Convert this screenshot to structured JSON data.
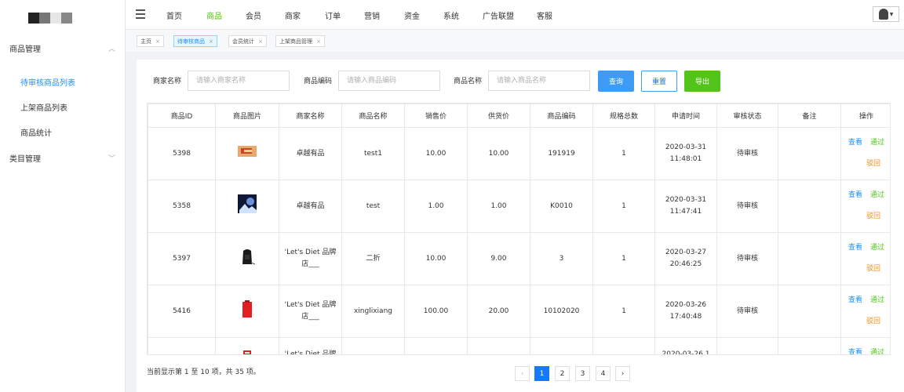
{
  "nav": {
    "items": [
      "首页",
      "商品",
      "会员",
      "商家",
      "订单",
      "营销",
      "资金",
      "系统",
      "广告联盟",
      "客服"
    ],
    "active": "商品"
  },
  "sidebar": {
    "groups": [
      {
        "label": "商品管理",
        "items": [
          "待审核商品列表",
          "上架商品列表",
          "商品统计"
        ],
        "active": "待审核商品列表"
      },
      {
        "label": "类目管理"
      }
    ]
  },
  "tabs": [
    "主页",
    "待审核商品",
    "会员统计",
    "上架商品管理"
  ],
  "active_tab": "待审核商品",
  "filters": [
    {
      "label": "商家名称",
      "placeholder": "请输入商家名称"
    },
    {
      "label": "商品编码",
      "placeholder": "请输入商品编码"
    },
    {
      "label": "商品名称",
      "placeholder": "请输入商品名称"
    }
  ],
  "buttons": {
    "query": "查询",
    "reset": "重置",
    "export": "导出"
  },
  "table": {
    "columns": [
      "商品ID",
      "商品图片",
      "商家名称",
      "商品名称",
      "销售价",
      "供货价",
      "商品编码",
      "规格总数",
      "申请时间",
      "审核状态",
      "备注",
      "操作"
    ],
    "rows": [
      {
        "id": "5398",
        "image": "orange-card-thumb",
        "merchant": "卓越有品",
        "name": "test1",
        "price": "10.00",
        "supply": "10.00",
        "code": "191919",
        "specs": "1",
        "time": "2020-03-31 11:48:01",
        "status": "待审核",
        "note": ""
      },
      {
        "id": "5358",
        "image": "dark-blue-photo-thumb",
        "merchant": "卓越有品",
        "name": "test",
        "price": "1.00",
        "supply": "1.00",
        "code": "K0010",
        "specs": "1",
        "time": "2020-03-31 11:47:41",
        "status": "待审核",
        "note": ""
      },
      {
        "id": "5397",
        "image": "black-backpack-thumb",
        "merchant": "'Let's Diet 品牌店___",
        "name": "二折",
        "price": "10.00",
        "supply": "9.00",
        "code": "3",
        "specs": "1",
        "time": "2020-03-27 20:46:25",
        "status": "待审核",
        "note": ""
      },
      {
        "id": "5416",
        "image": "red-bag-thumb",
        "merchant": "'Let's Diet 品牌店___",
        "name": "xinglixiang",
        "price": "100.00",
        "supply": "20.00",
        "code": "10102020",
        "specs": "1",
        "time": "2020-03-26 17:40:48",
        "status": "待审核",
        "note": ""
      },
      {
        "id": "",
        "image": "red-item-thumb",
        "merchant": "'Let's Diet 品牌",
        "name": "",
        "price": "",
        "supply": "",
        "code": "",
        "specs": "",
        "time": "2020-03-26 1",
        "status": "",
        "note": ""
      }
    ],
    "actions": {
      "view": "查看",
      "pass": "通过",
      "reject": "驳回"
    }
  },
  "pagination": {
    "info": "当前显示第 1 至 10 项，共 35 项。",
    "prev": "‹",
    "pages": [
      "1",
      "2",
      "3",
      "4"
    ],
    "current": "1",
    "next": "›"
  },
  "colors": {
    "accent": "#1890ff",
    "green": "#52c41a",
    "orange": "#fa8c16"
  }
}
